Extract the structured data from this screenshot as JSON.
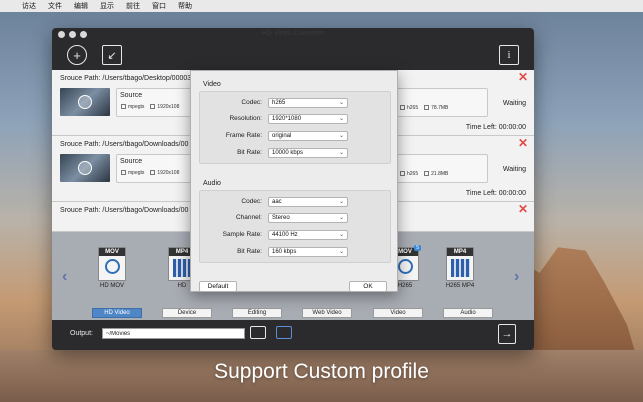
{
  "menubar": {
    "apple": "",
    "items": [
      "访达",
      "文件",
      "编辑",
      "显示",
      "前往",
      "窗口",
      "帮助"
    ]
  },
  "window": {
    "title": "HD Video Converter",
    "toolbar": {
      "add_icon": "plus-circle-icon",
      "import_icon": "import-arrow-icon",
      "info_icon": "info-icon",
      "info_glyph": "i"
    }
  },
  "tasks": [
    {
      "path_label": "Srouce Path:",
      "path": "/Users/tbago/Desktop/00003",
      "source_label": "Source",
      "src_codec": "mpegts",
      "src_res": "1920x108",
      "out_codec": "h265",
      "out_size": "78.7MB",
      "status": "Waiting",
      "time_left_label": "Time Left:",
      "time_left": "00:00:00"
    },
    {
      "path_label": "Srouce Path:",
      "path": "/Users/tbago/Downloads/00",
      "source_label": "Source",
      "src_codec": "mpegts",
      "src_res": "1920x108",
      "out_codec": "h265",
      "out_size": "21.8MB",
      "status": "Waiting",
      "time_left_label": "Time Left:",
      "time_left": "00:00:00"
    },
    {
      "path_label": "Srouce Path:",
      "path": "/Users/tbago/Downloads/00"
    }
  ],
  "formats": [
    {
      "tag": "MOV",
      "name": "HD MOV",
      "emblem": "quicktime"
    },
    {
      "tag": "MP4",
      "name": "HD",
      "emblem": "film"
    },
    {
      "tag": "MOV",
      "name": "H265",
      "emblem": "quicktime",
      "badge": "5"
    },
    {
      "tag": "MP4",
      "name": "H265 MP4",
      "emblem": "film"
    }
  ],
  "categories": [
    {
      "label": "HD Video",
      "active": true
    },
    {
      "label": "Device",
      "active": false
    },
    {
      "label": "Editing",
      "active": false
    },
    {
      "label": "Web Video",
      "active": false
    },
    {
      "label": "Video",
      "active": false
    },
    {
      "label": "Audio",
      "active": false
    }
  ],
  "output": {
    "label": "Output:",
    "path": "~/Movies"
  },
  "dialog": {
    "video_title": "Video",
    "audio_title": "Audio",
    "video_fields": [
      {
        "label": "Codec:",
        "value": "h265"
      },
      {
        "label": "Resolution:",
        "value": "1920*1080"
      },
      {
        "label": "Frame Rate:",
        "value": "original"
      },
      {
        "label": "Bit Rate:",
        "value": "10000 kbps"
      }
    ],
    "audio_fields": [
      {
        "label": "Codec:",
        "value": "aac"
      },
      {
        "label": "Channel:",
        "value": "Stereo"
      },
      {
        "label": "Sample Rate:",
        "value": "44100 Hz"
      },
      {
        "label": "Bit Rate:",
        "value": "160 kbps"
      }
    ],
    "default_label": "Default",
    "ok_label": "OK"
  },
  "caption": "Support Custom profile",
  "colors": {
    "accent": "#4f86c6",
    "close": "#e24a4a"
  }
}
